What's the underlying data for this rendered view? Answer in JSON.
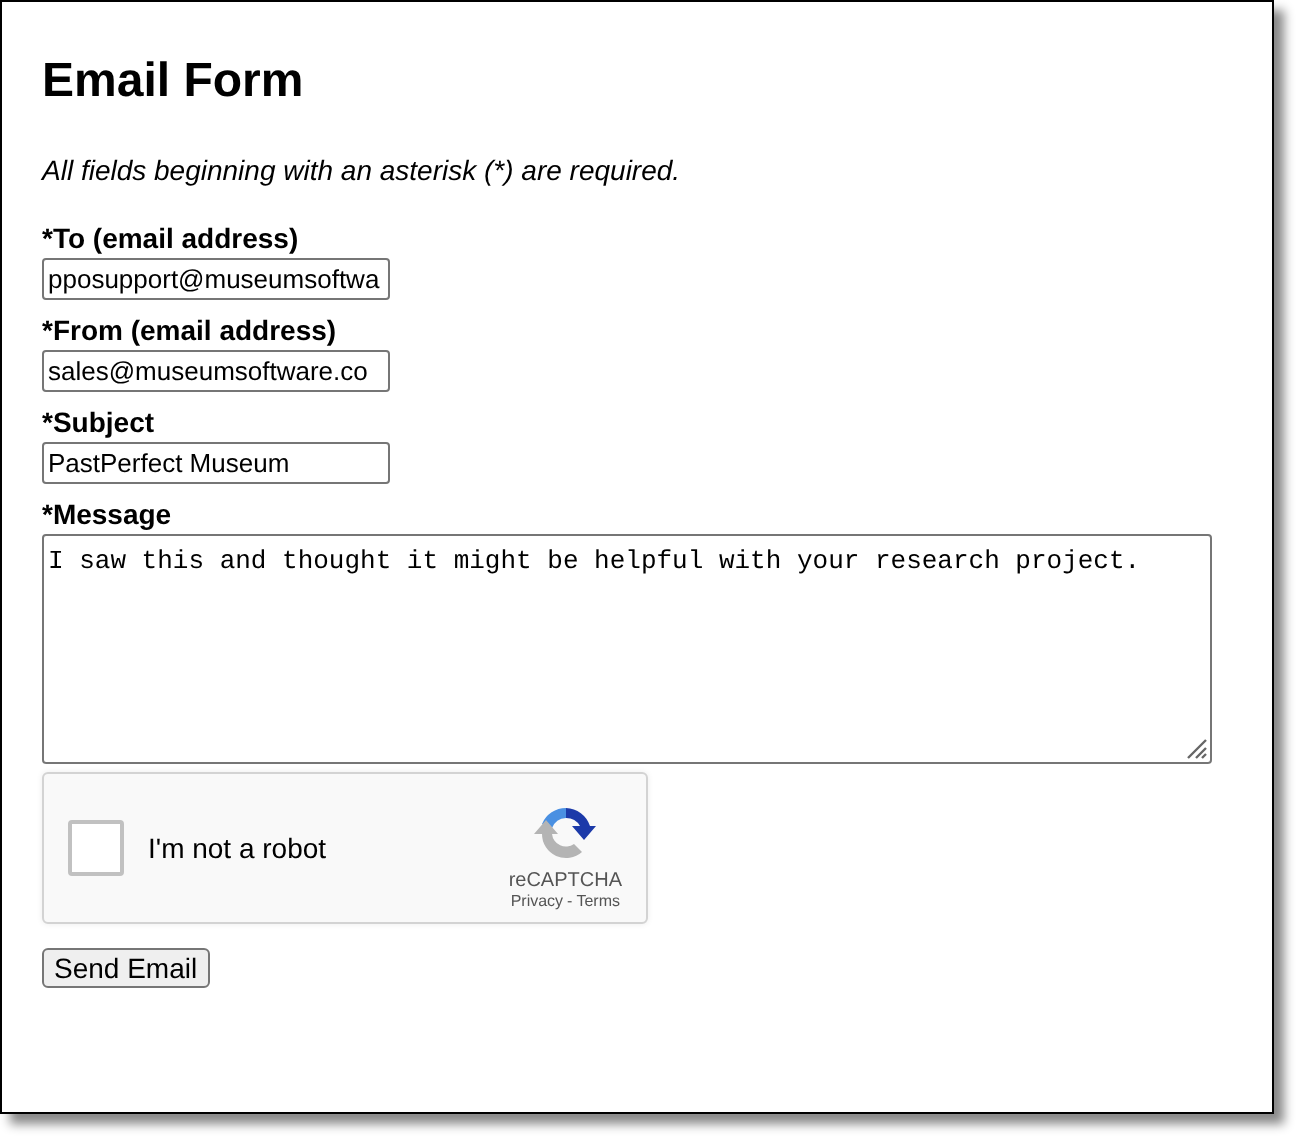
{
  "title": "Email Form",
  "note": "All fields beginning with an asterisk (*) are required.",
  "fields": [
    {
      "kind": "input",
      "label": "*To (email address)",
      "value": "pposupport@museumsoftwa"
    },
    {
      "kind": "input",
      "label": "*From (email address)",
      "value": "sales@museumsoftware.co"
    },
    {
      "kind": "input",
      "label": "*Subject",
      "value": "PastPerfect Museum"
    },
    {
      "kind": "textarea",
      "label": "*Message",
      "value": "I saw this and thought it might be helpful with your research project."
    }
  ],
  "captcha": {
    "label": "I'm not a robot",
    "checked": false,
    "brand": "reCAPTCHA",
    "privacy": "Privacy",
    "separator": "-",
    "terms": "Terms"
  },
  "submit": "Send Email"
}
